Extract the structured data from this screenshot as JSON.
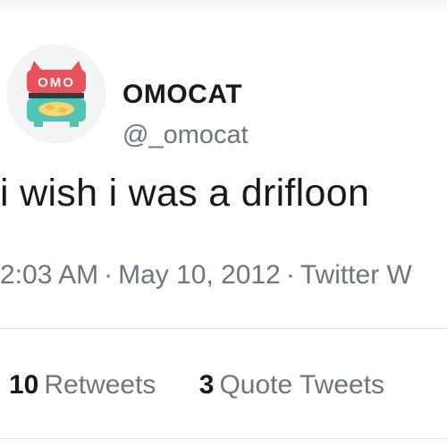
{
  "tweet": {
    "author": {
      "display_name": "OMOCAT",
      "handle": "@_omocat",
      "avatar_logo_text": "OMO"
    },
    "text": "i wish i was a drifloon",
    "timestamp": "2:03 AM",
    "separator": "·",
    "date": "May 10, 2012",
    "source": "Twitter W",
    "stats": {
      "retweets_count": "10",
      "retweets_label": "Retweets",
      "quotes_count": "3",
      "quotes_label": "Quote Tweets"
    }
  },
  "colors": {
    "text_primary": "#1a1a1a",
    "text_secondary": "#6e767d",
    "avatar_red": "#e8525a",
    "avatar_teal": "#4fc3b4",
    "avatar_yellow": "#f5d76e"
  }
}
